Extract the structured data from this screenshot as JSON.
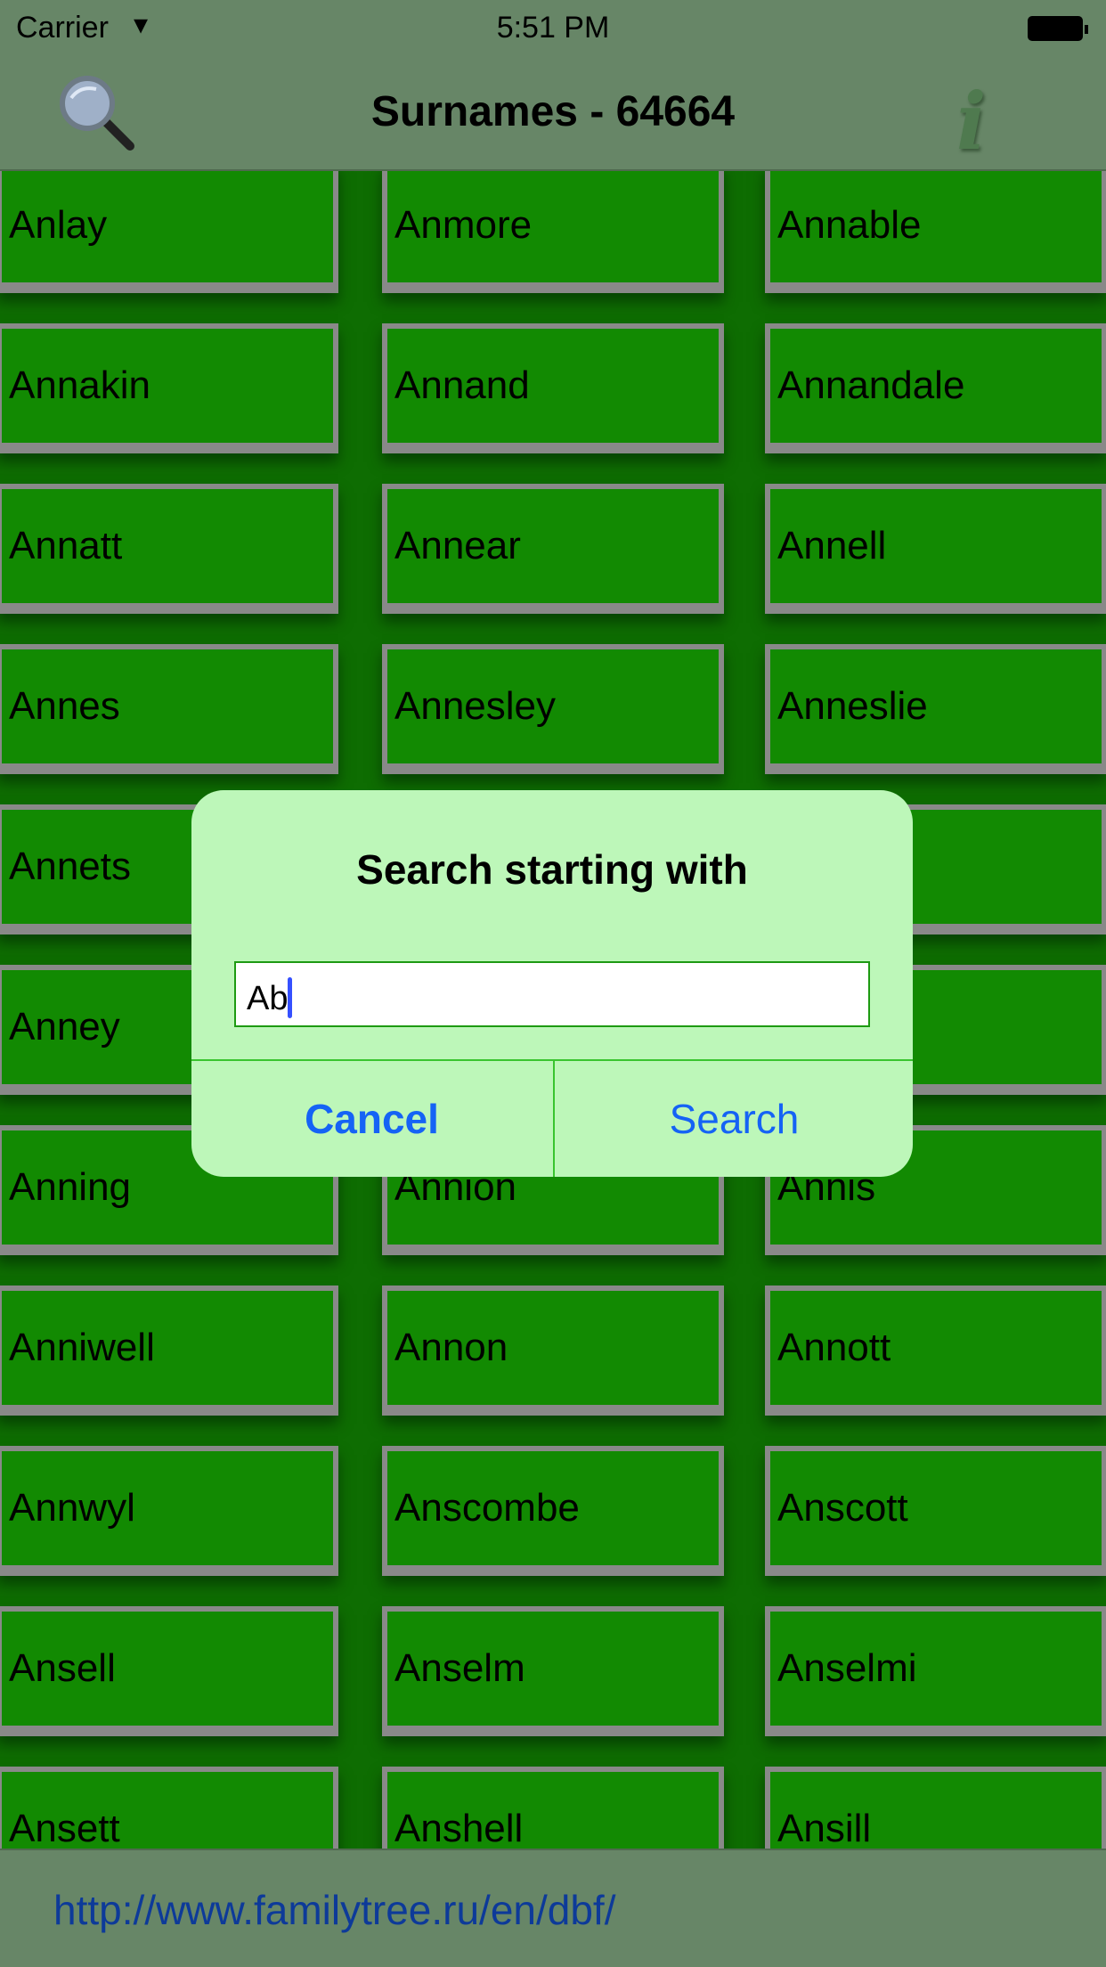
{
  "status_bar": {
    "carrier": "Carrier",
    "time": "5:51 PM"
  },
  "nav": {
    "title": "Surnames - 64664",
    "left_icon": "magnifier-icon",
    "right_icon": "info-icon"
  },
  "grid": {
    "rows": [
      [
        "Anlay",
        "Anmore",
        "Annable"
      ],
      [
        "Annakin",
        "Annand",
        "Annandale"
      ],
      [
        "Annatt",
        "Annear",
        "Annell"
      ],
      [
        "Annes",
        "Annesley",
        "Anneslie"
      ],
      [
        "Annets",
        "",
        ""
      ],
      [
        "Anney",
        "",
        ""
      ],
      [
        "Anning",
        "Annion",
        "Annis"
      ],
      [
        "Anniwell",
        "Annon",
        "Annott"
      ],
      [
        "Annwyl",
        "Anscombe",
        "Anscott"
      ],
      [
        "Ansell",
        "Anselm",
        "Anselmi"
      ],
      [
        "Ansett",
        "Anshell",
        "Ansill"
      ]
    ]
  },
  "footer": {
    "link": "http://www.familytree.ru/en/dbf/"
  },
  "dialog": {
    "title": "Search starting with",
    "input_value": "Ab",
    "cancel_label": "Cancel",
    "search_label": "Search"
  },
  "colors": {
    "cell": "#128a02",
    "bar": "#678667",
    "dialog": "#bdf7b9",
    "button_text": "#1563f5"
  }
}
